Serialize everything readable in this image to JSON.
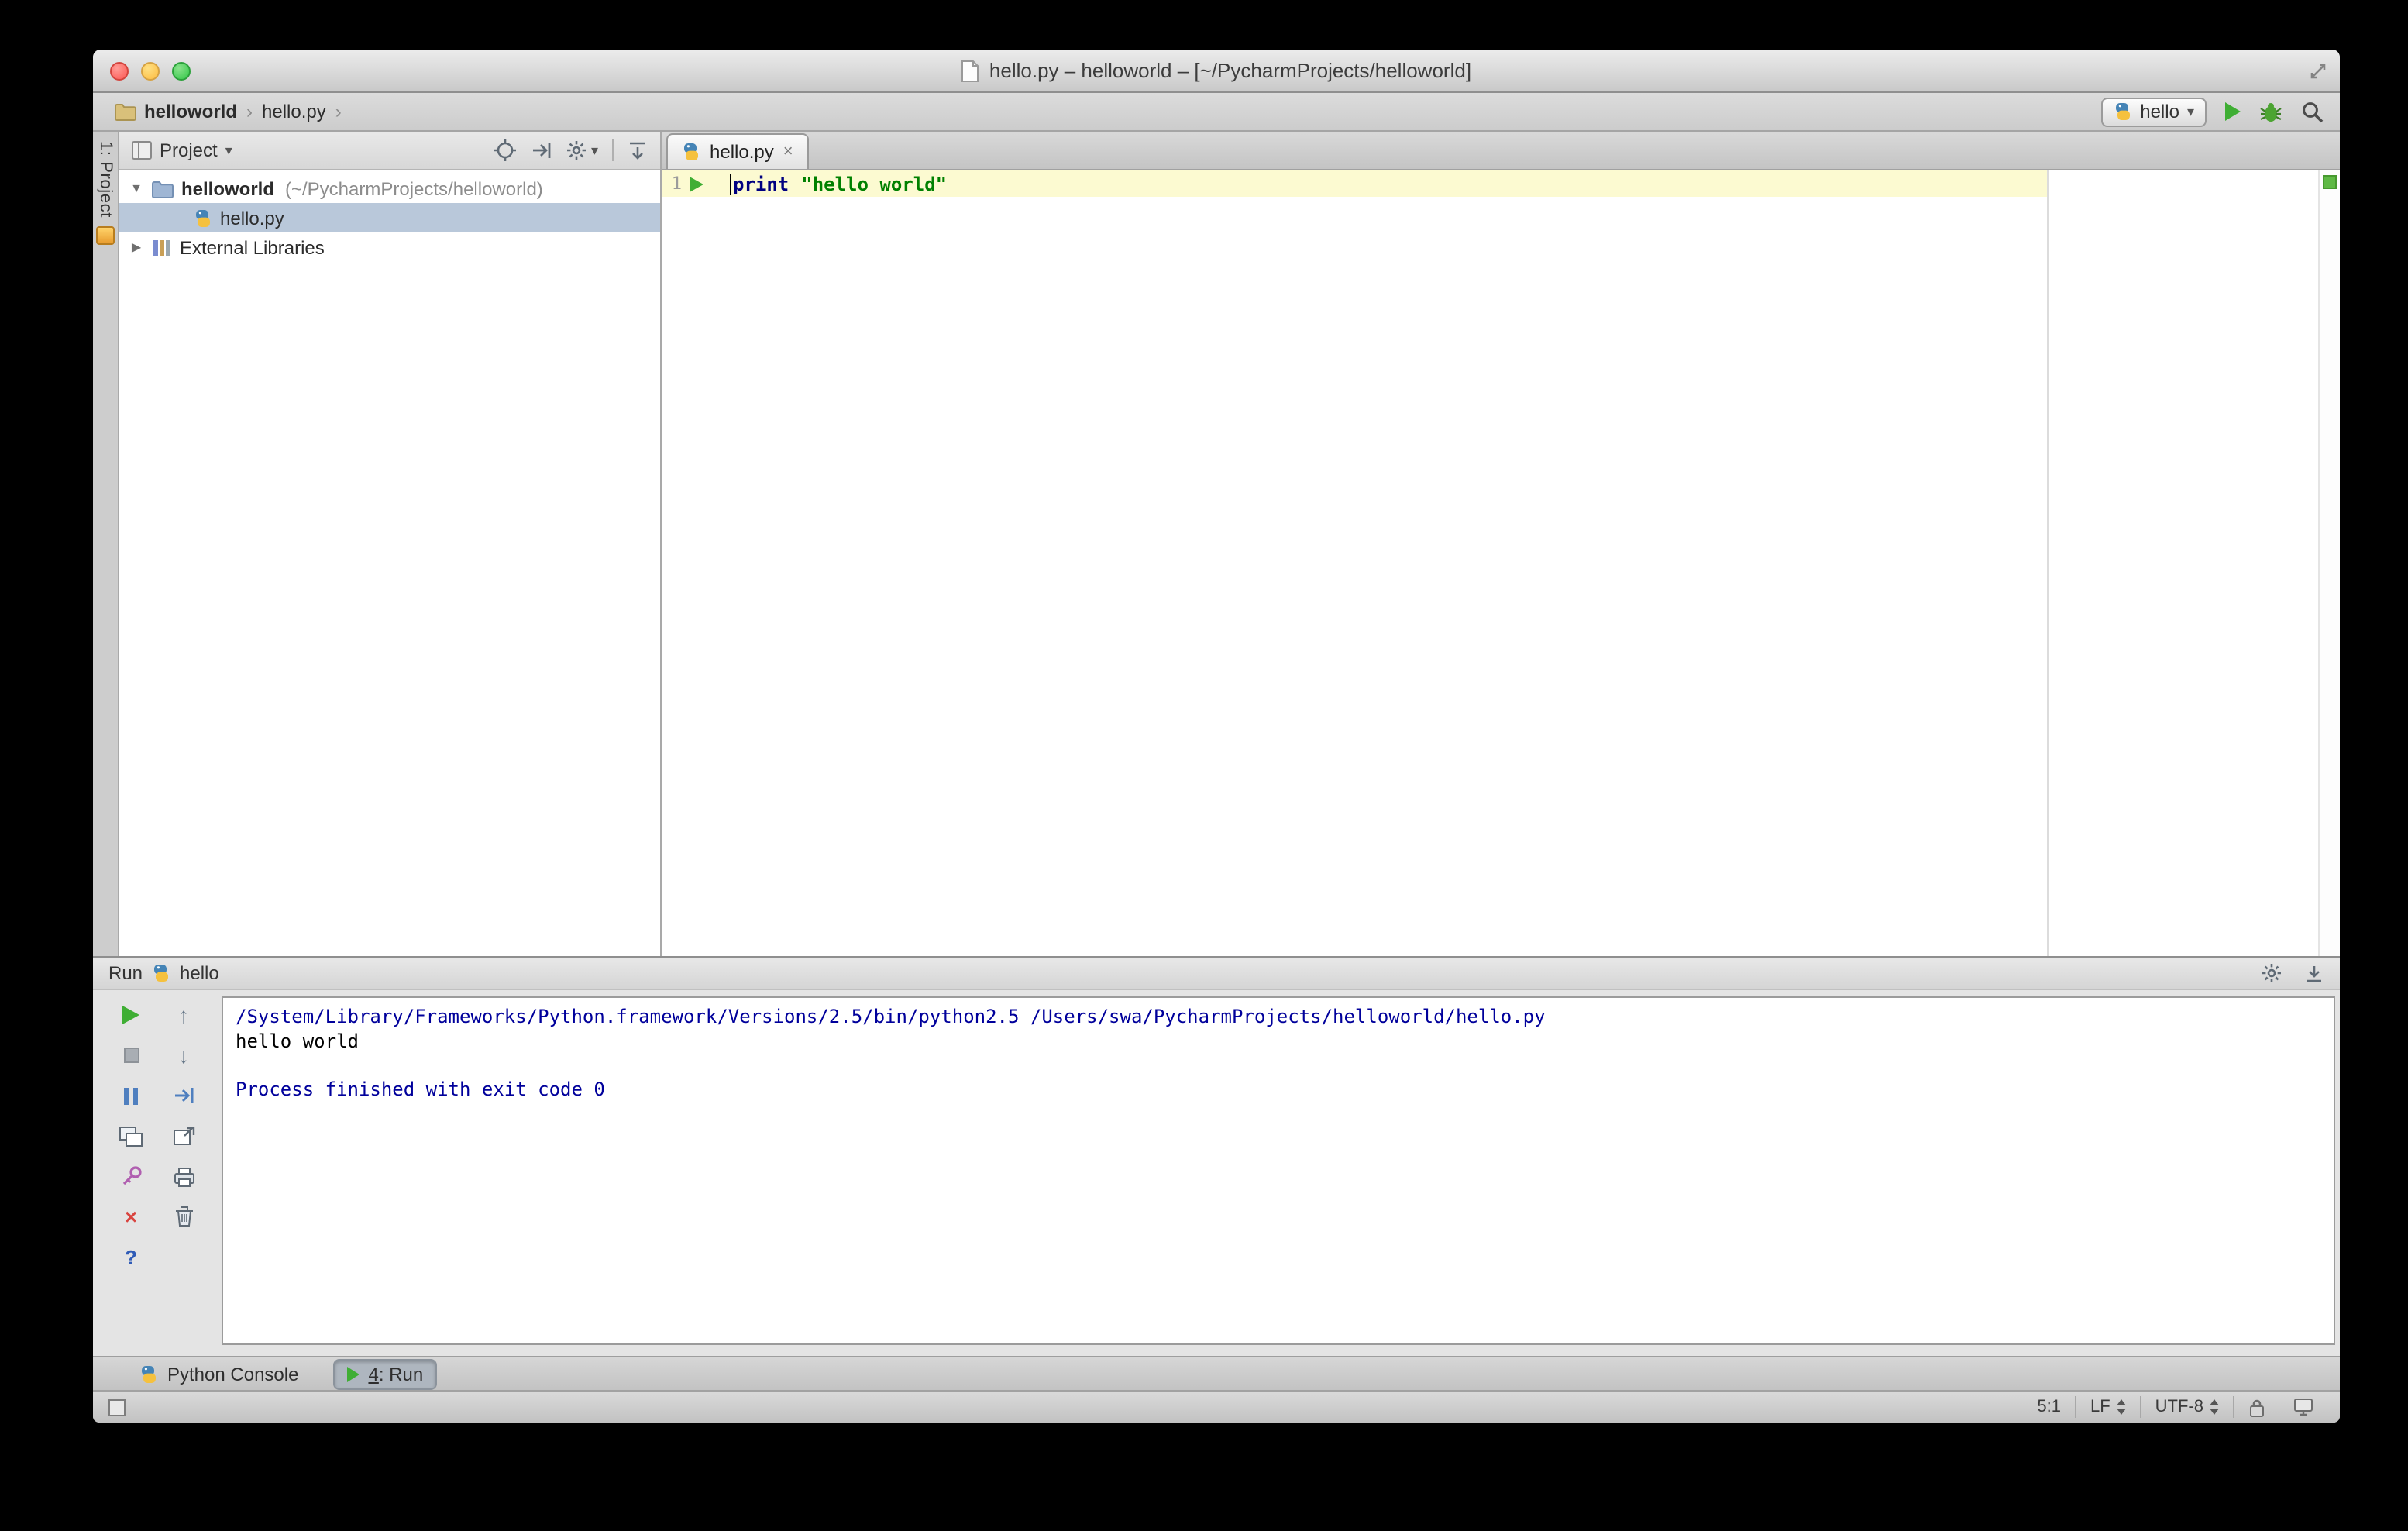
{
  "window": {
    "title": "hello.py – helloworld – [~/PycharmProjects/helloworld]"
  },
  "navbar": {
    "breadcrumbs": {
      "project": "helloworld",
      "file": "hello.py",
      "separator": "›"
    },
    "run_config": {
      "label": "hello"
    }
  },
  "tool_strip": {
    "project_button": "1: Project"
  },
  "project_panel": {
    "header": {
      "title": "Project"
    },
    "tree": {
      "root": {
        "name": "helloworld",
        "path": "(~/PycharmProjects/helloworld)"
      },
      "file": {
        "name": "hello.py"
      },
      "libraries": {
        "name": "External Libraries"
      }
    }
  },
  "editor": {
    "tab": {
      "label": "hello.py"
    },
    "line_number": "1",
    "code": {
      "keyword": "print",
      "string": "\"hello world\""
    }
  },
  "run_panel": {
    "title": "Run",
    "config": "hello",
    "console": [
      {
        "text": "/System/Library/Frameworks/Python.framework/Versions/2.5/bin/python2.5 /Users/swa/PycharmProjects/helloworld/hello.py",
        "cls": "blue"
      },
      {
        "text": "hello world",
        "cls": "black"
      },
      {
        "text": "",
        "cls": "black"
      },
      {
        "text": "Process finished with exit code 0",
        "cls": "blue"
      }
    ]
  },
  "bottom_bar": {
    "python_console": "Python Console",
    "run_tab": {
      "mnemonic": "4",
      "rest": ": Run"
    }
  },
  "status_bar": {
    "caret": "5:1",
    "line_ending": "LF",
    "encoding": "UTF-8"
  },
  "icons": {
    "dropdown": "▾",
    "twisty_open": "▼",
    "twisty_closed": "▶",
    "close": "×",
    "up": "↑",
    "down": "↓",
    "help": "?"
  }
}
